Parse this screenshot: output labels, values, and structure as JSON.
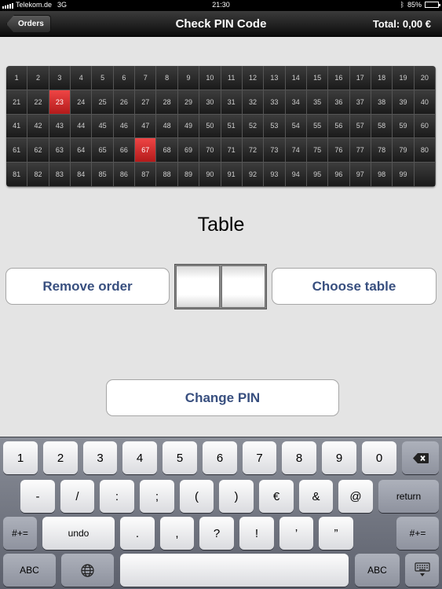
{
  "status_bar": {
    "carrier": "Telekom.de",
    "network": "3G",
    "time": "21:30",
    "battery": "85%",
    "battery_level": 0.85
  },
  "nav": {
    "back_label": "Orders",
    "title": "Check PIN Code",
    "total": "Total: 0,00 €"
  },
  "tables": {
    "numbers": [
      1,
      2,
      3,
      4,
      5,
      6,
      7,
      8,
      9,
      10,
      11,
      12,
      13,
      14,
      15,
      16,
      17,
      18,
      19,
      20,
      21,
      22,
      23,
      24,
      25,
      26,
      27,
      28,
      29,
      30,
      31,
      32,
      33,
      34,
      35,
      36,
      37,
      38,
      39,
      40,
      41,
      42,
      43,
      44,
      45,
      46,
      47,
      48,
      49,
      50,
      51,
      52,
      53,
      54,
      55,
      56,
      57,
      58,
      59,
      60,
      61,
      62,
      63,
      64,
      65,
      66,
      67,
      68,
      69,
      70,
      71,
      72,
      73,
      74,
      75,
      76,
      77,
      78,
      79,
      80,
      81,
      82,
      83,
      84,
      85,
      86,
      87,
      88,
      89,
      90,
      91,
      92,
      93,
      94,
      95,
      96,
      97,
      98,
      99
    ],
    "selected": [
      23,
      67
    ],
    "selected_color": "#d82828"
  },
  "main": {
    "table_label": "Table",
    "remove_order_label": "Remove order",
    "choose_table_label": "Choose table",
    "change_pin_label": "Change PIN",
    "pin_digits": [
      "",
      ""
    ]
  },
  "keyboard": {
    "row1": [
      "1",
      "2",
      "3",
      "4",
      "5",
      "6",
      "7",
      "8",
      "9",
      "0"
    ],
    "row2": [
      "-",
      "/",
      ":",
      ";",
      "(",
      ")",
      "€",
      "&",
      "@"
    ],
    "return_label": "return",
    "row3": [
      ".",
      ",",
      "?",
      "!",
      "’",
      "”"
    ],
    "symbols_label": "#+=",
    "undo_label": "undo",
    "abc_label": "ABC",
    "icons": {
      "backspace": "backspace-icon",
      "globe": "globe-icon",
      "hide": "keyboard-hide-icon"
    }
  }
}
